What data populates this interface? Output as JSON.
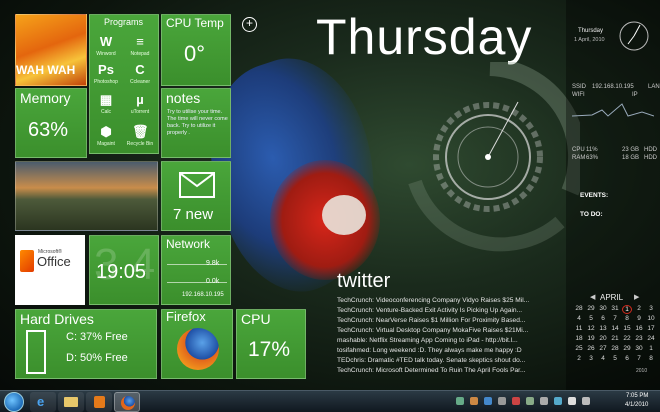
{
  "tiles": {
    "wallpaper_text": "WAH WAH",
    "programs": {
      "title": "Programs",
      "items": [
        {
          "label": "Winword",
          "glyph": "W"
        },
        {
          "label": "Notepad",
          "glyph": "≡"
        },
        {
          "label": "Photoshop",
          "glyph": "Ps"
        },
        {
          "label": "Ccleaner",
          "glyph": "C"
        },
        {
          "label": "Calc",
          "glyph": "▦"
        },
        {
          "label": "uTorrent",
          "glyph": "µ"
        },
        {
          "label": "Magaint",
          "glyph": "⬢"
        },
        {
          "label": "Recycle Bin",
          "glyph": "🗑"
        }
      ]
    },
    "cpu_temp": {
      "title": "CPU Temp",
      "value": "0°"
    },
    "memory": {
      "title": "Memory",
      "value": "63%"
    },
    "notes": {
      "title": "notes",
      "text": "Try to utilise your time. The time will never come back. Try to utilize it properly ."
    },
    "mail": {
      "count": "7 new"
    },
    "office": {
      "brand_small": "Microsoft®",
      "brand": "Office"
    },
    "clock": {
      "time": "19:05",
      "bg_digits": "3 4"
    },
    "network": {
      "title": "Network",
      "up": "9.8k",
      "down": "0.0k",
      "ip": "192.168.10.195"
    },
    "hard_drives": {
      "title": "Hard Drives",
      "c": "C: 37% Free",
      "d": "D: 50% Free"
    },
    "firefox": {
      "title": "Firefox"
    },
    "cpu": {
      "title": "CPU",
      "value": "17%"
    }
  },
  "day": "Thursday",
  "twitter": {
    "title": "twitter",
    "lines": [
      "TechCrunch: Videoconferencing Company Vidyo Raises $25 Mil...",
      "TechCrunch: Venture-Backed Exit Activity Is Picking Up Again...",
      "TechCrunch: NearVerse Raises $1 Million For Proximity Based...",
      "TechCrunch: Virtual Desktop Company MokaFive Raises $21Mi...",
      "mashable: Netflix Streaming App Coming to iPad - http://bit.l...",
      "tosifahmed: Long weekend :D. They always make me happy :D",
      "TEDchris: Dramatic #TED talk today. Senate skeptics shout do...",
      "TechCrunch: Microsoft Determined To Ruin The April Fools Par..."
    ]
  },
  "sidebar": {
    "date_day": "Thursday",
    "date_full": "1 April, 2010",
    "net_rows": [
      "SSID",
      "WIFI",
      "IP",
      "LAN"
    ],
    "net_ip": "192.168.10.195",
    "sys_rows": [
      {
        "k": "CPU",
        "v": "11%",
        "x": "23 GB",
        "y": "HDD"
      },
      {
        "k": "RAM",
        "v": "63%",
        "x": "18 GB",
        "y": "HDD"
      }
    ],
    "events_label": "EVENTS:",
    "todo_label": "TO DO:",
    "cal_month": "APRIL",
    "cal_year": "2010",
    "cal_days": [
      "29",
      "30",
      "31",
      "1",
      "2",
      "3",
      "5",
      "6",
      "7",
      "8",
      "9",
      "10",
      "12",
      "13",
      "14",
      "15",
      "16",
      "17",
      "19",
      "20",
      "21",
      "22",
      "23",
      "24",
      "26",
      "27",
      "28",
      "29",
      "30",
      "1",
      "3",
      "4",
      "5",
      "6",
      "7",
      "8"
    ],
    "cal_rowstart": [
      "28",
      "4",
      "11",
      "18",
      "25",
      "2"
    ]
  },
  "taskbar": {
    "time": "7:05 PM",
    "date": "4/1/2010"
  },
  "colors": {
    "tile_green": "#3f962f",
    "accent_red": "#d42a1e"
  }
}
